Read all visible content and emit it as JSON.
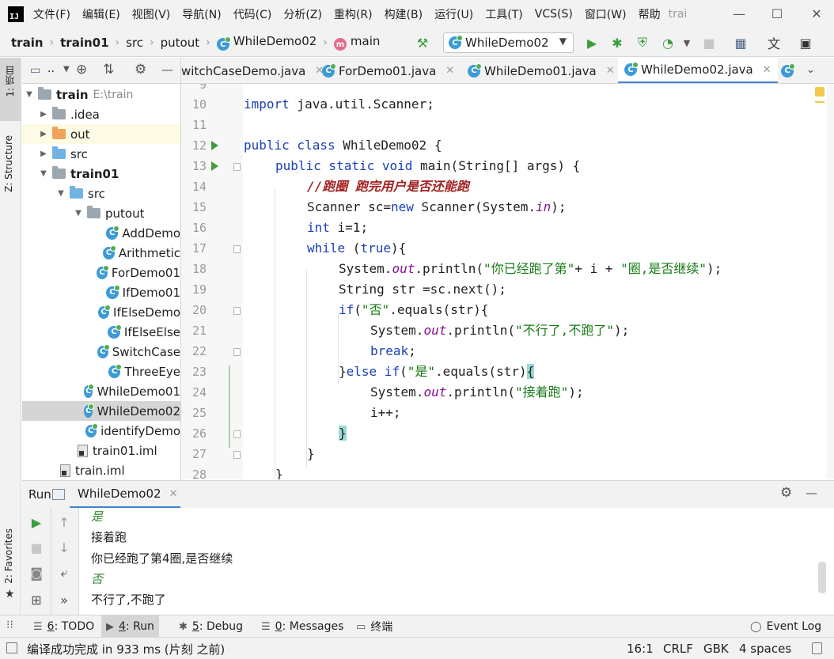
{
  "window": {
    "menus": [
      "文件(F)",
      "编辑(E)",
      "视图(V)",
      "导航(N)",
      "代码(C)",
      "分析(Z)",
      "重构(R)",
      "构建(B)",
      "运行(U)",
      "工具(T)",
      "VCS(S)",
      "窗口(W)",
      "帮助"
    ],
    "title": "trai"
  },
  "navbar": {
    "crumbs": [
      "train",
      "train01",
      "src",
      "putout",
      "WhileDemo02",
      "main"
    ],
    "run_config": "WhileDemo02"
  },
  "left_strip": {
    "project_tab": "1: 项目",
    "structure_tab": "Z: Structure",
    "favorites_tab": "2: Favorites"
  },
  "project_tree": {
    "root": "train",
    "root_path": "E:\\train",
    "idea": ".idea",
    "out": "out",
    "src": "src",
    "module": "train01",
    "module_src": "src",
    "package": "putout",
    "files": [
      "AddDemo",
      "Arithmetic",
      "ForDemo01",
      "IfDemo01",
      "IfElseDemo",
      "IfElseElse",
      "SwitchCase",
      "ThreeEye",
      "WhileDemo01",
      "WhileDemo02"
    ],
    "identify": "identifyDemo",
    "iml_module": "train01.iml",
    "iml_root": "train.iml"
  },
  "editor": {
    "tabs": [
      "witchCaseDemo.java",
      "ForDemo01.java",
      "WhileDemo01.java",
      "WhileDemo02.java"
    ],
    "active_tab": "WhileDemo02.java",
    "line_numbers": [
      "9",
      "10",
      "11",
      "12",
      "13",
      "14",
      "15",
      "16",
      "17",
      "18",
      "19",
      "20",
      "21",
      "22",
      "23",
      "24",
      "25",
      "26",
      "27",
      "28"
    ],
    "code": {
      "l10_kw": "import",
      "l10_rest": " java.util.Scanner;",
      "l12_kw": "public class",
      "l12_rest": " WhileDemo02 {",
      "l13_kw": "public static void",
      "l13_rest": " main(String[] args) {",
      "l14_cmt": "//跑圈 跑完用户是否还能跑",
      "l15_a": "Scanner sc=",
      "l15_kw": "new",
      "l15_b": " Scanner(System.",
      "l15_fld": "in",
      "l15_c": ");",
      "l16_kw": "int",
      "l16_rest": " i=1;",
      "l17_kw": "while",
      "l17_a": " (",
      "l17_kw2": "true",
      "l17_b": "){",
      "l18_a": "System.",
      "l18_fld": "out",
      "l18_b": ".println(",
      "l18_s1": "\"你已经跑了第\"",
      "l18_c": "+ i + ",
      "l18_s2": "\"圈,是否继续\"",
      "l18_d": ");",
      "l19": "String str =sc.next();",
      "l20_kw": "if",
      "l20_a": "(",
      "l20_s": "\"否\"",
      "l20_b": ".equals(str){",
      "l21_a": "System.",
      "l21_fld": "out",
      "l21_b": ".println(",
      "l21_s": "\"不行了,不跑了\"",
      "l21_c": ");",
      "l22_kw": "break",
      "l22_rest": ";",
      "l23_a": "}",
      "l23_kw": "else if",
      "l23_b": "(",
      "l23_s": "\"是\"",
      "l23_c": ".equals(str)",
      "l23_d": "{",
      "l24_a": "System.",
      "l24_fld": "out",
      "l24_b": ".println(",
      "l24_s": "\"接着跑\"",
      "l24_c": ");",
      "l25": "i++;",
      "l26": "}",
      "l27": "}",
      "l28": "}"
    }
  },
  "run_panel": {
    "label": "Run:",
    "tab": "WhileDemo02",
    "console": [
      "是",
      "接着跑",
      "你已经跑了第4圈,是否继续",
      "否",
      "不行了,不跑了"
    ]
  },
  "bottom_tools": {
    "todo_num": "6",
    "todo_label": ": TODO",
    "run_num": "4",
    "run_label": ": Run",
    "debug_num": "5",
    "debug_label": ": Debug",
    "messages_num": "0",
    "messages_label": ": Messages",
    "terminal": "终端",
    "event_log": "Event Log"
  },
  "status": {
    "message": "编译成功完成 in 933 ms (片刻 之前)",
    "position": "16:1",
    "line_sep": "CRLF",
    "encoding": "GBK",
    "indent": "4 spaces"
  },
  "colors": {
    "accent": "#4083c9",
    "keyword": "#1a3fb5",
    "string": "#167b16",
    "run_green": "#3d9e3d"
  }
}
